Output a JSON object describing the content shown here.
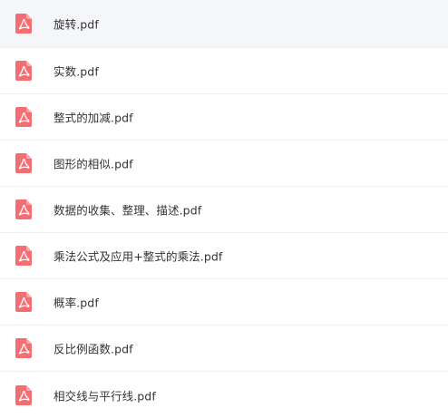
{
  "files": [
    {
      "name": "旋转.pdf",
      "icon": "pdf-file-icon",
      "selected": true
    },
    {
      "name": "实数.pdf",
      "icon": "pdf-file-icon",
      "selected": false
    },
    {
      "name": "整式的加减.pdf",
      "icon": "pdf-file-icon",
      "selected": false
    },
    {
      "name": "图形的相似.pdf",
      "icon": "pdf-file-icon",
      "selected": false
    },
    {
      "name": "数据的收集、整理、描述.pdf",
      "icon": "pdf-file-icon",
      "selected": false
    },
    {
      "name": "乘法公式及应用+整式的乘法.pdf",
      "icon": "pdf-file-icon",
      "selected": false
    },
    {
      "name": "概率.pdf",
      "icon": "pdf-file-icon",
      "selected": false
    },
    {
      "name": "反比例函数.pdf",
      "icon": "pdf-file-icon",
      "selected": false
    },
    {
      "name": "相交线与平行线.pdf",
      "icon": "pdf-file-icon",
      "selected": false
    }
  ],
  "colors": {
    "pdf_icon": "#f46d73",
    "selected_row_bg": "#f5f6fa",
    "text": "#333333",
    "divider": "#f0f1f4"
  }
}
